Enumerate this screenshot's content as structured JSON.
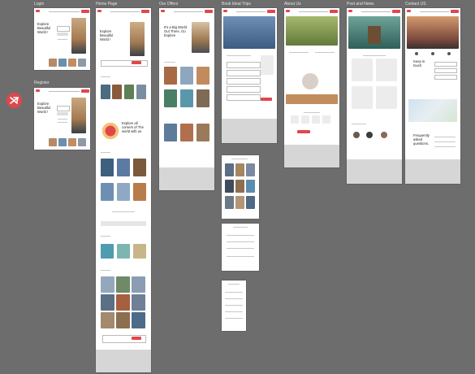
{
  "frames": {
    "login": {
      "title": "Login",
      "hero_text": "Explore Beautiful World !",
      "button_label": "Sign in"
    },
    "register": {
      "title": "Register",
      "hero_text": "Explore Beautiful World !",
      "button_label": "Sign up"
    },
    "home": {
      "title": "Home Page",
      "hero_text": "Explore Beautiful World !",
      "about_text": "Explore all corners of The world with us"
    },
    "offers": {
      "title": "Our Offers",
      "hero_text": "It's a Big World Out There, Go Explore"
    },
    "book": {
      "title": "Book Ideal Trips"
    },
    "about": {
      "title": "About Us"
    },
    "post": {
      "title": "Post and News"
    },
    "contact": {
      "title": "Contact US",
      "keep_touch": "Keep in touch",
      "faq": "Frequently asked questions."
    }
  },
  "colors": {
    "background": "#6d6d6d",
    "accent": "#e0474c",
    "footer": "#d6d6d6",
    "frame": "#ffffff"
  },
  "icons": {
    "logo": "airplane-badge-icon"
  }
}
